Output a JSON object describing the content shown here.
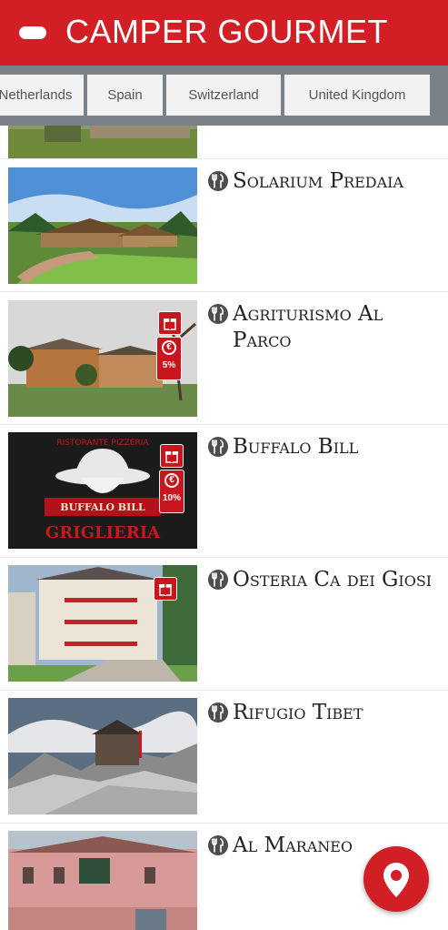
{
  "header": {
    "title": "CAMPER GOURMET",
    "back_icon": "back-pill-icon"
  },
  "country_tabs": [
    {
      "label": "Netherlands"
    },
    {
      "label": "Spain"
    },
    {
      "label": "Switzerland"
    },
    {
      "label": "United Kingdom"
    }
  ],
  "restaurants": [
    {
      "name": "Solarium Predaia",
      "badges": []
    },
    {
      "name": "Agriturismo Al Parco",
      "badges": [
        "gift",
        "discount"
      ],
      "discount": "5%"
    },
    {
      "name": "Buffalo Bill",
      "badges": [
        "gift",
        "discount"
      ],
      "discount": "10%"
    },
    {
      "name": "Osteria Ca dei Giosi",
      "badges": [
        "gift"
      ]
    },
    {
      "name": "Rifugio Tibet",
      "badges": []
    },
    {
      "name": "Al Maraneo",
      "badges": []
    }
  ],
  "thumb_text": {
    "buffalo_sign": "BUFFALO BILL",
    "buffalo_grill": "GRIGLIERIA",
    "buffalo_arc": "RISTORANTE PIZZERIA",
    "euro": "€"
  },
  "colors": {
    "brand": "#d21f26",
    "tab_bar": "#7b8287",
    "tab": "#f2f2f2"
  },
  "fab": {
    "icon": "map-pin-icon"
  }
}
